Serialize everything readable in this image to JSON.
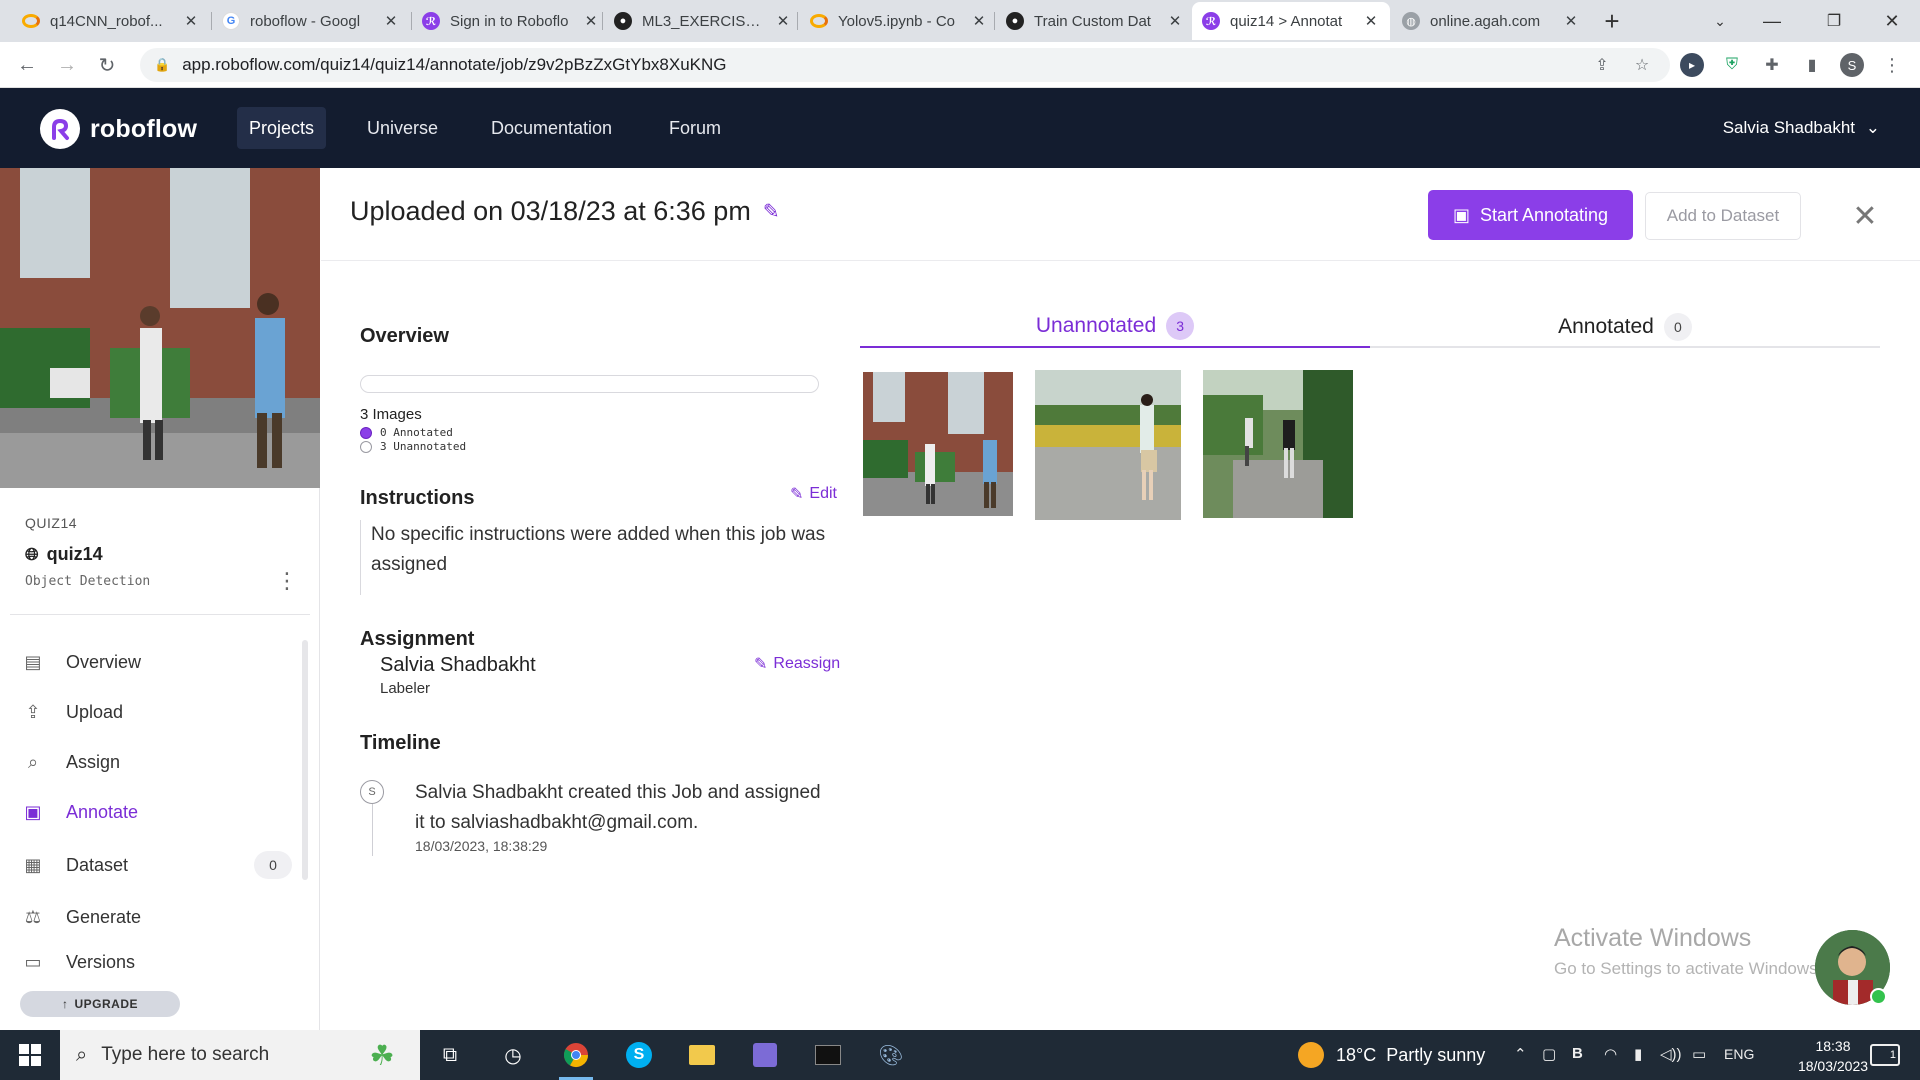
{
  "browser": {
    "tabs": [
      {
        "title": "q14CNN_robof...",
        "icon": "colab-icon"
      },
      {
        "title": "roboflow - Googl",
        "icon": "google-icon"
      },
      {
        "title": "Sign in to Roboflo",
        "icon": "roboflow-icon"
      },
      {
        "title": "ML3_EXERCISE/3.",
        "icon": "github-icon"
      },
      {
        "title": "Yolov5.ipynb - Co",
        "icon": "colab-icon"
      },
      {
        "title": "Train Custom Dat",
        "icon": "github-icon"
      },
      {
        "title": "quiz14 > Annotat",
        "icon": "roboflow-icon",
        "active": true
      },
      {
        "title": "online.agah.com",
        "icon": "globe-icon"
      }
    ],
    "url": "app.roboflow.com/quiz14/quiz14/annotate/job/z9v2pBzZxGtYbx8XuKNG",
    "profile_initial": "S"
  },
  "nav": {
    "brand": "roboflow",
    "links": [
      "Projects",
      "Universe",
      "Documentation",
      "Forum"
    ],
    "active_link": "Projects",
    "user": "Salvia Shadbakht"
  },
  "project": {
    "kicker": "QUIZ14",
    "name": "quiz14",
    "type": "Object Detection"
  },
  "sidebar": {
    "items": [
      {
        "label": "Overview",
        "icon": "overview-icon"
      },
      {
        "label": "Upload",
        "icon": "upload-icon"
      },
      {
        "label": "Assign",
        "icon": "search-icon"
      },
      {
        "label": "Annotate",
        "icon": "annotate-icon",
        "active": true
      },
      {
        "label": "Dataset",
        "icon": "dataset-icon",
        "count": "0"
      },
      {
        "label": "Generate",
        "icon": "generate-icon"
      },
      {
        "label": "Versions",
        "icon": "versions-icon"
      }
    ],
    "upgrade": "UPGRADE"
  },
  "job": {
    "title": "Uploaded on 03/18/23 at 6:36 pm",
    "start_button": "Start Annotating",
    "add_button": "Add to Dataset"
  },
  "overview": {
    "title": "Overview",
    "image_count": "3 Images",
    "annotated": "0 Annotated",
    "unannotated": "3 Unannotated",
    "progress_fraction": 0
  },
  "instructions": {
    "title": "Instructions",
    "edit": "Edit",
    "text": "No specific instructions were added when this job was assigned"
  },
  "assignment": {
    "title": "Assignment",
    "name": "Salvia Shadbakht",
    "role": "Labeler",
    "reassign": "Reassign"
  },
  "timeline": {
    "title": "Timeline",
    "avatar": "S",
    "text": "Salvia Shadbakht created this Job and assigned it to salviashadbakht@gmail.com.",
    "date": "18/03/2023, 18:38:29"
  },
  "image_tabs": {
    "unannotated_label": "Unannotated",
    "unannotated_count": "3",
    "annotated_label": "Annotated",
    "annotated_count": "0"
  },
  "watermark": {
    "title": "Activate Windows",
    "subtitle": "Go to Settings to activate Windows."
  },
  "taskbar": {
    "search_placeholder": "Type here to search",
    "weather": "18°C  Partly sunny",
    "lang": "ENG",
    "time": "18:38",
    "date": "18/03/2023",
    "notifications": "1"
  }
}
